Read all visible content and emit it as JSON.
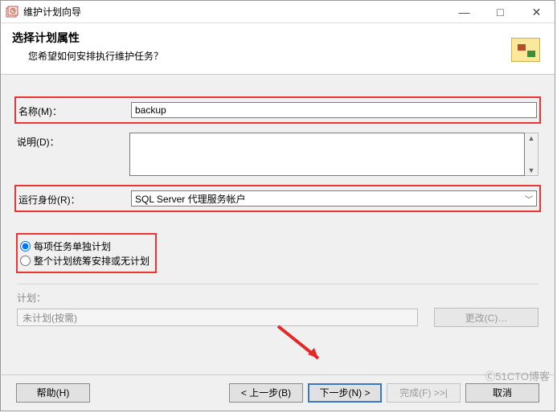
{
  "window": {
    "title": "维护计划向导"
  },
  "header": {
    "title": "选择计划属性",
    "subtitle": "您希望如何安排执行维护任务？"
  },
  "form": {
    "name_label": "名称(M)：",
    "name_value": "backup",
    "desc_label": "说明(D)：",
    "desc_value": "",
    "runas_label": "运行身份(R)：",
    "runas_value": "SQL Server 代理服务帐户"
  },
  "radios": {
    "opt_separate": "每项任务单独计划",
    "opt_single": "整个计划统筹安排或无计划"
  },
  "plan": {
    "section_label": "计划：",
    "value": "未计划(按需)",
    "change_button": "更改(C)…"
  },
  "buttons": {
    "help": "帮助(H)",
    "back": "< 上一步(B)",
    "next": "下一步(N) >",
    "finish": "完成(F) >>|",
    "cancel": "取消"
  },
  "watermark": "Ⓒ51CTO博客"
}
